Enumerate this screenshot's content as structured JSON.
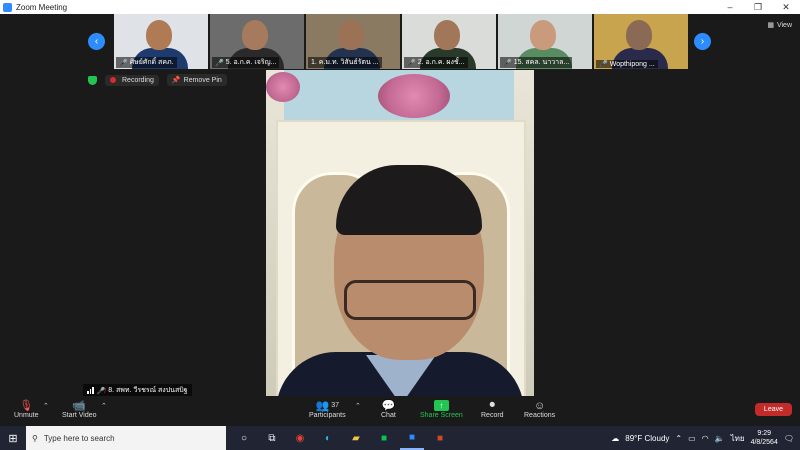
{
  "titlebar": {
    "title": "Zoom Meeting",
    "min": "–",
    "restore": "❐",
    "close": "✕"
  },
  "thumbnails": [
    {
      "name": "ศิษย์ศักดิ์ สคภ.",
      "muted": true,
      "bg": "#dfe3e8",
      "skin": "#b07a55",
      "shirt": "#1e3b6e"
    },
    {
      "name": "5. อ.ก.ค. เจริญ...",
      "muted": true,
      "bg": "#6c6c6c",
      "skin": "#a67a5c",
      "shirt": "#2a2a2a"
    },
    {
      "name": "1. ค.ม.ท. วิสันธ์รัตน ...",
      "muted": false,
      "bg": "#8a7a62",
      "skin": "#9c7257",
      "shirt": "#22324f"
    },
    {
      "name": "2. อ.ก.ค. ผงชั้...",
      "muted": true,
      "bg": "#d9dcd8",
      "skin": "#a27659",
      "shirt": "#2a3a2a"
    },
    {
      "name": "15. สคล. นาวาล...",
      "muted": true,
      "bg": "#d0d6d4",
      "skin": "#c99a7c",
      "shirt": "#5a8c62"
    },
    {
      "name": "Wopthipong ...",
      "muted": true,
      "bg": "#c9a44f",
      "skin": "#8a6a55",
      "shirt": "#2a2a4a"
    }
  ],
  "view_label": "View",
  "status": {
    "recording": "Recording",
    "remove_pin": "Remove Pin"
  },
  "main_speaker": {
    "name": "8. สพท. วีรชรณ์ สงปนสบิฐ",
    "muted": true
  },
  "toolbar": {
    "unmute": "Unmute",
    "start_video": "Start Video",
    "participants": "Participants",
    "participants_count": "37",
    "chat": "Chat",
    "share_screen": "Share Screen",
    "record": "Record",
    "reactions": "Reactions",
    "leave": "Leave"
  },
  "taskbar": {
    "search_placeholder": "Type here to search",
    "weather": "89°F  Cloudy",
    "lang": "ไทย",
    "time": "9:29",
    "date": "4/8/2564"
  }
}
